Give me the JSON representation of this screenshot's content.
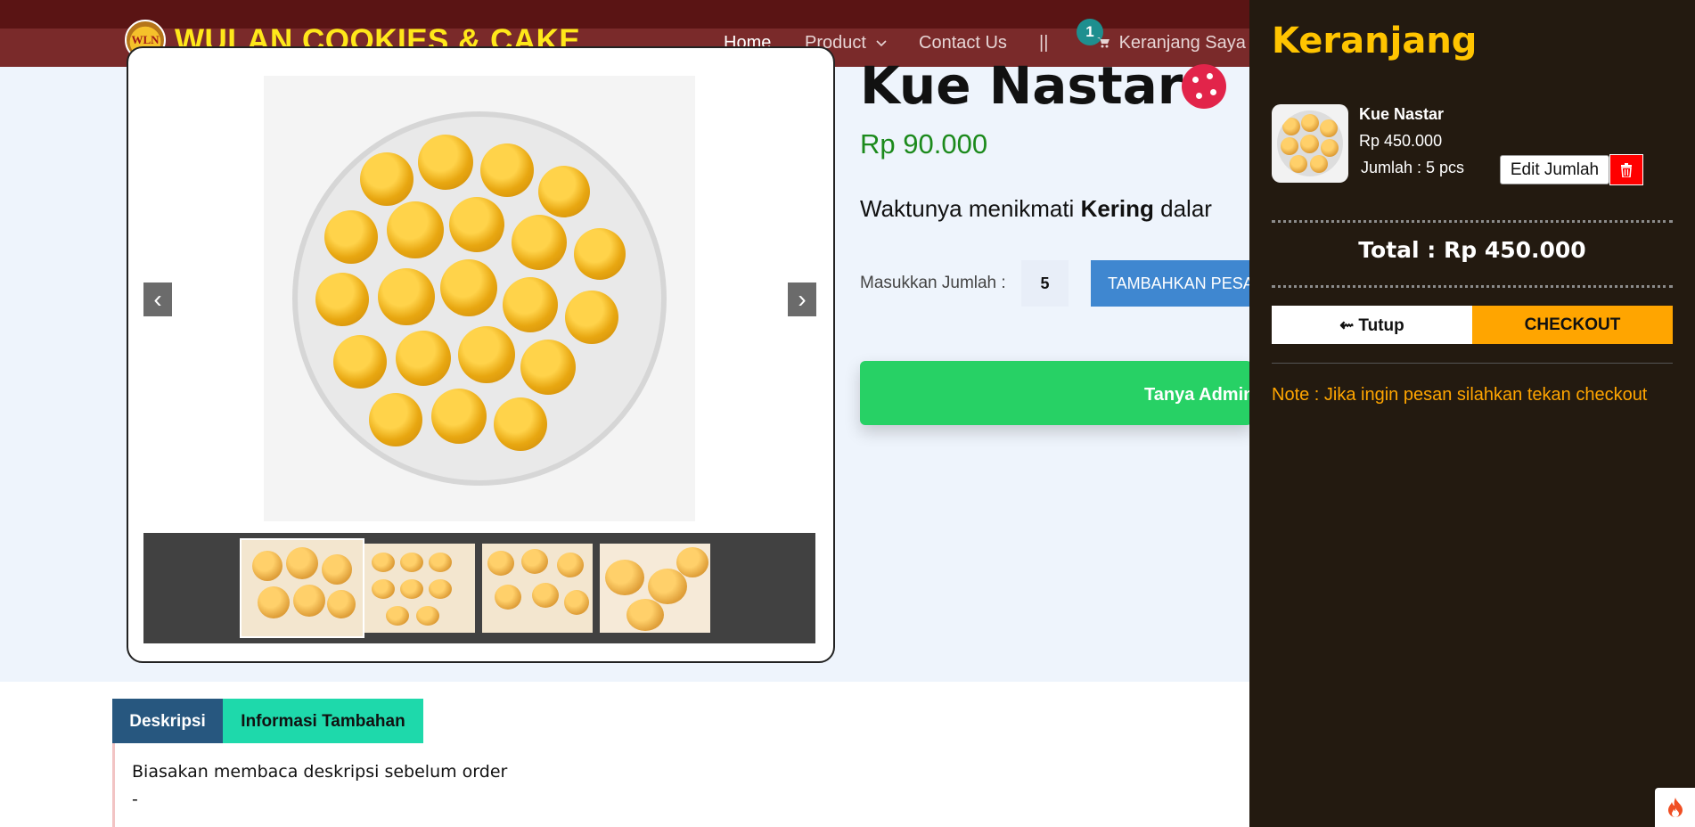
{
  "header": {
    "logo_text": "WLN",
    "brand": "WULAN COOKIES & CAKE",
    "nav": {
      "home": "Home",
      "product": "Product",
      "contact": "Contact Us",
      "separator": "||",
      "cart": "Keranjang Saya"
    },
    "cart_badge": "1"
  },
  "product": {
    "title": "Kue Nastar",
    "price": "Rp 90.000",
    "tagline_pre": "Waktunya menikmati ",
    "tagline_bold": "Kering",
    "tagline_post": " dalar",
    "qty_label": "Masukkan Jumlah :",
    "qty_value": "5",
    "add_button": "TAMBAHKAN PESANAN",
    "whatsapp_button": "Tanya Admin",
    "gallery": {
      "prev": "‹",
      "next": "›"
    }
  },
  "tabs": {
    "description": "Deskripsi",
    "additional_info": "Informasi Tambahan"
  },
  "description": {
    "line1": "Biasakan membaca deskripsi sebelum order",
    "line2": "-"
  },
  "cart": {
    "title": "Keranjang",
    "items": [
      {
        "name": "Kue Nastar",
        "price": "Rp 450.000",
        "qty": "Jumlah : 5 pcs",
        "edit_label": "Edit Jumlah"
      }
    ],
    "total": "Total : Rp 450.000",
    "close_button": "⇜ Tutup",
    "checkout_button": "CHECKOUT",
    "note": "Note : Jika ingin pesan silahkan tekan checkout"
  },
  "colors": {
    "brand_yellow": "#ffe81a",
    "cart_accent": "#ffc400",
    "checkout_orange": "#ffa500",
    "price_green": "#1c8a1c",
    "whatsapp_green": "#27d165",
    "delete_red": "#ff0000"
  }
}
